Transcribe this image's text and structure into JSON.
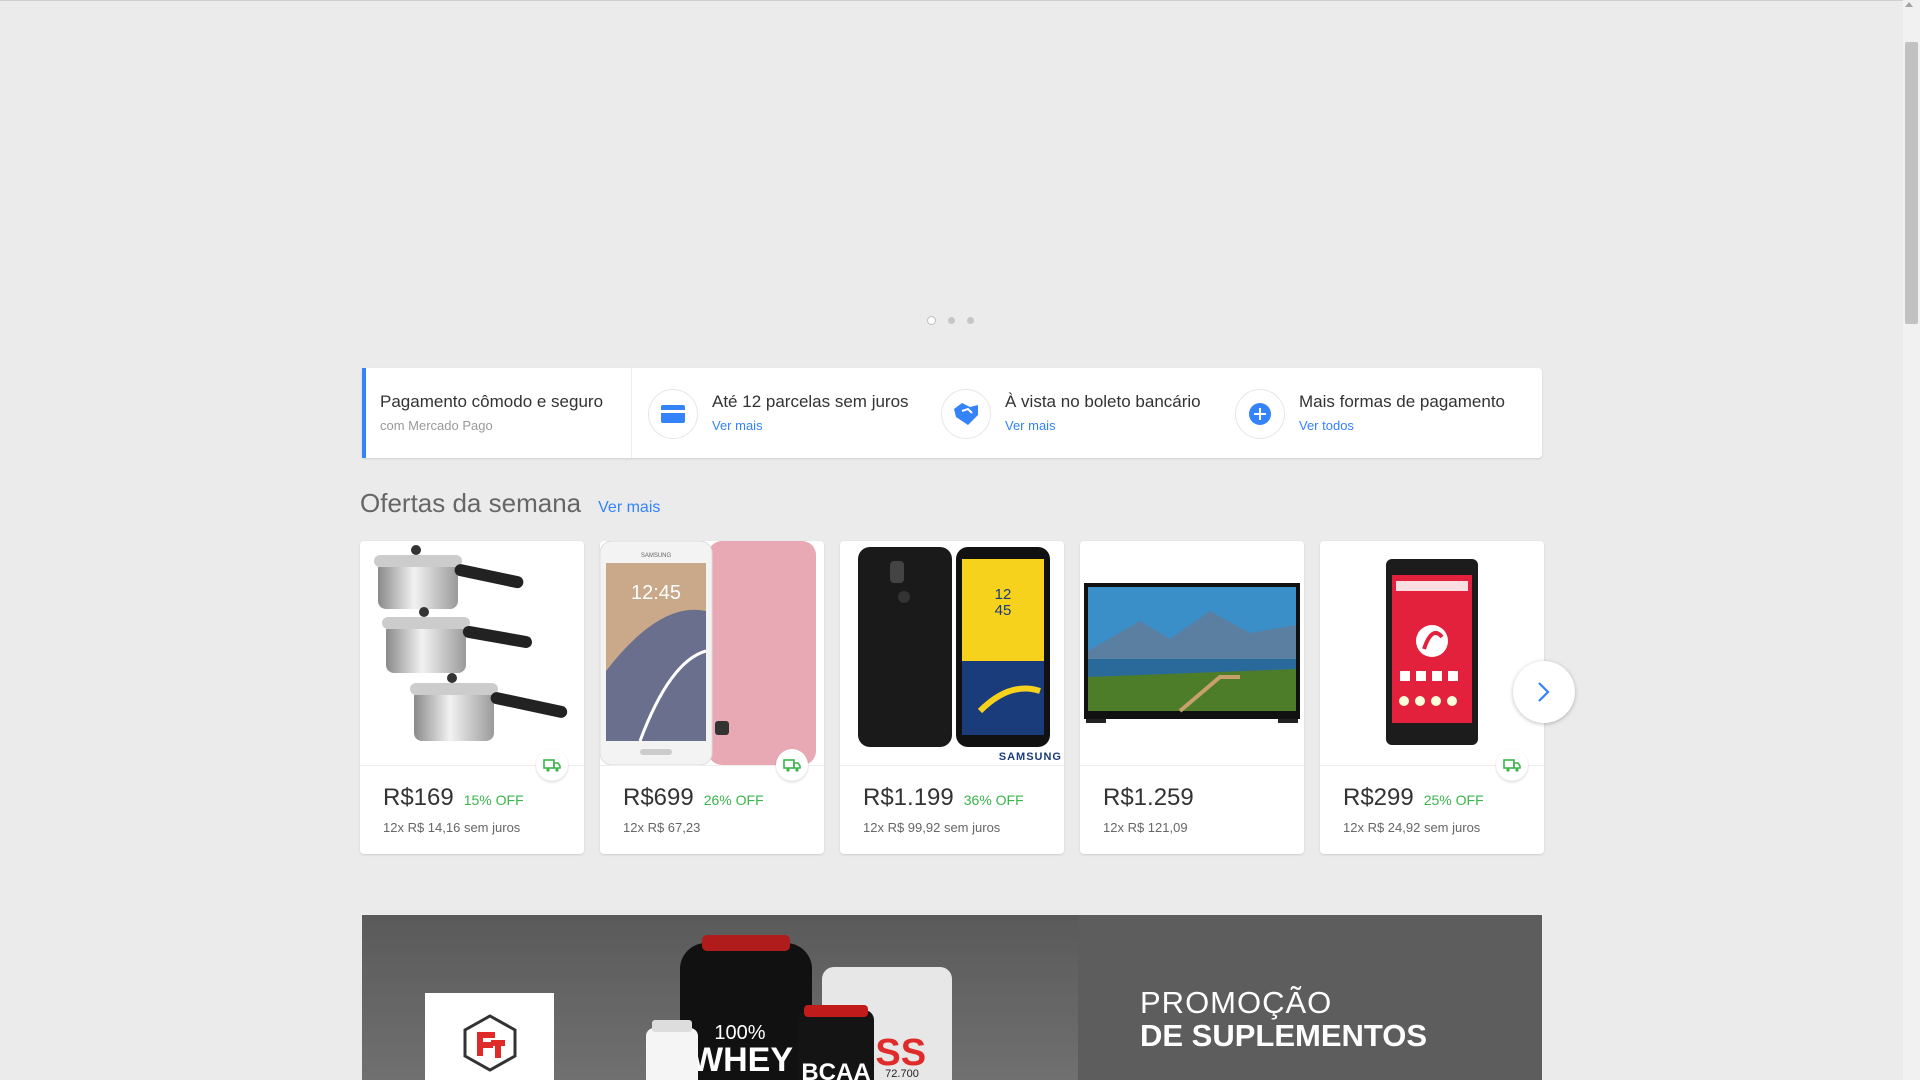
{
  "carousel": {
    "dots": 3,
    "active_index": 0
  },
  "payment": {
    "title": "Pagamento cômodo e seguro",
    "subtitle": "com Mercado Pago",
    "items": [
      {
        "icon": "credit-card-icon",
        "label": "Até 12 parcelas sem juros",
        "link": "Ver mais"
      },
      {
        "icon": "boleto-handshake-icon",
        "label": "À vista no boleto bancário",
        "link": "Ver mais"
      },
      {
        "icon": "plus-circle-icon",
        "label": "Mais formas de pagamento",
        "link": "Ver todos"
      }
    ]
  },
  "offers": {
    "title": "Ofertas da semana",
    "link": "Ver mais",
    "products": [
      {
        "image": "pressure-cookers",
        "price": "R$169",
        "discount": "15% OFF",
        "installments": "12x R$ 14,16 sem juros",
        "free_shipping": true
      },
      {
        "image": "samsung-phone-pink",
        "price": "R$699",
        "discount": "26% OFF",
        "installments": "12x R$ 67,23",
        "free_shipping": true
      },
      {
        "image": "samsung-galaxy-j8",
        "price": "R$1.199",
        "discount": "36% OFF",
        "installments": "12x R$ 99,92 sem juros",
        "free_shipping": false,
        "brand_label": "SAMSUNG"
      },
      {
        "image": "smart-tv",
        "price": "R$1.259",
        "discount": "",
        "installments": "12x R$ 121,09",
        "free_shipping": false
      },
      {
        "image": "red-android-phone",
        "price": "R$299",
        "discount": "25% OFF",
        "installments": "12x R$ 24,92 sem juros",
        "free_shipping": true
      }
    ]
  },
  "promo": {
    "line1": "PROMOÇÃO",
    "line2": "DE SUPLEMENTOS",
    "product_text": [
      "100%",
      "WHEY",
      "BCAA",
      "ASS",
      "72.700"
    ]
  },
  "colors": {
    "accent": "#3483fa",
    "discount": "#39b54a",
    "background": "#ebebeb"
  }
}
